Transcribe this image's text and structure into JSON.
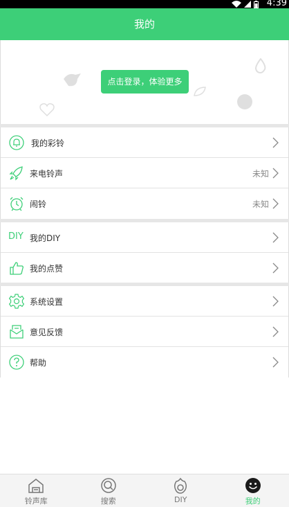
{
  "status_bar": {
    "time": "4:39"
  },
  "header": {
    "title": "我的"
  },
  "banner": {
    "login_label": "点击登录，体验更多"
  },
  "menu_groups": [
    [
      {
        "name": "my-ringback",
        "label": "我的彩铃",
        "value": "",
        "icon": "bell-icon"
      },
      {
        "name": "caller-ringtone",
        "label": "来电铃声",
        "value": "未知",
        "icon": "rocket-icon"
      },
      {
        "name": "alarm",
        "label": "闹铃",
        "value": "未知",
        "icon": "alarm-clock-icon"
      }
    ],
    [
      {
        "name": "my-diy",
        "label": "我的DIY",
        "value": "",
        "icon": "diy-icon",
        "icon_text": "DIY"
      },
      {
        "name": "my-likes",
        "label": "我的点赞",
        "value": "",
        "icon": "thumbs-up-icon"
      }
    ],
    [
      {
        "name": "settings",
        "label": "系统设置",
        "value": "",
        "icon": "gear-icon"
      },
      {
        "name": "feedback",
        "label": "意见反馈",
        "value": "",
        "icon": "mail-icon"
      },
      {
        "name": "help",
        "label": "帮助",
        "value": "",
        "icon": "question-icon"
      }
    ]
  ],
  "tabs": [
    {
      "label": "铃声库",
      "icon": "home-icon",
      "active": false
    },
    {
      "label": "搜索",
      "icon": "search-icon",
      "active": false
    },
    {
      "label": "DIY",
      "icon": "diy-tab-icon",
      "active": false
    },
    {
      "label": "我的",
      "icon": "smiley-icon",
      "active": true
    }
  ],
  "colors": {
    "accent": "#3dcf78",
    "divider": "#e6e6e6"
  }
}
